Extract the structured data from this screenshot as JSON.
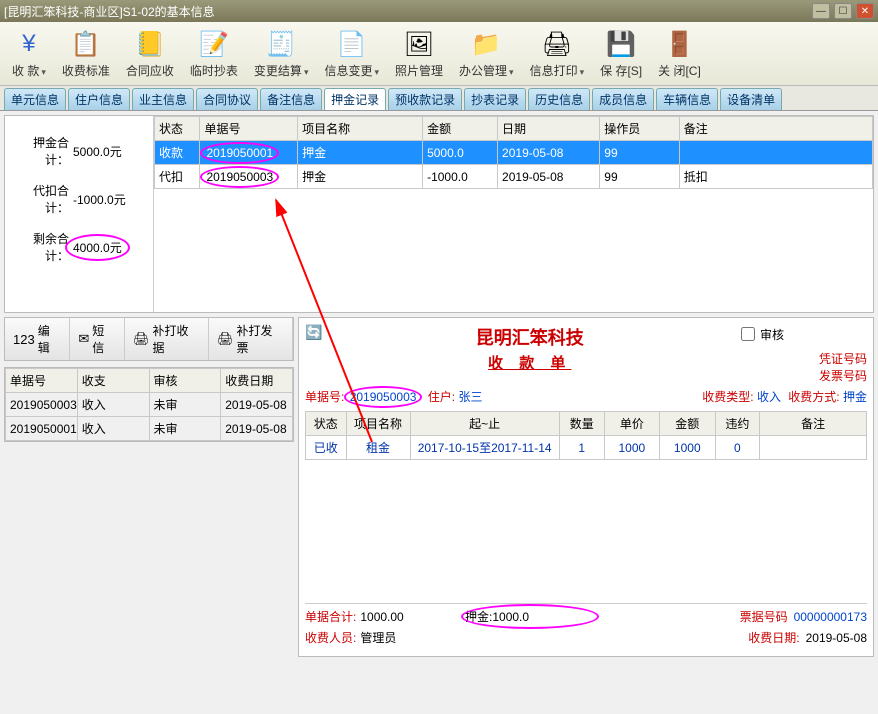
{
  "title": "[昆明汇笨科技-商业区]S1-02的基本信息",
  "toolbar": [
    {
      "icon": "¥",
      "color": "#3366cc",
      "label": "收 款",
      "dd": true
    },
    {
      "icon": "📋",
      "label": "收费标准"
    },
    {
      "icon": "📒",
      "label": "合同应收"
    },
    {
      "icon": "📝",
      "label": "临时抄表"
    },
    {
      "icon": "🧾",
      "label": "变更结算",
      "dd": true
    },
    {
      "icon": "📄",
      "label": "信息变更",
      "dd": true
    },
    {
      "icon": "🖼",
      "label": "照片管理"
    },
    {
      "icon": "📁",
      "label": "办公管理",
      "dd": true
    },
    {
      "icon": "🖨",
      "label": "信息打印",
      "dd": true
    },
    {
      "icon": "💾",
      "label": "保 存[S]"
    },
    {
      "icon": "🚪",
      "label": "关 闭[C]"
    }
  ],
  "tabs": [
    "单元信息",
    "住户信息",
    "业主信息",
    "合同协议",
    "备注信息",
    "押金记录",
    "预收款记录",
    "抄表记录",
    "历史信息",
    "成员信息",
    "车辆信息",
    "设备清单"
  ],
  "summary": {
    "deposit_label": "押金合计：",
    "deposit": "5000.0元",
    "deduct_label": "代扣合计：",
    "deduct": "-1000.0元",
    "remain_label": "剩余合计：",
    "remain": "4000.0元"
  },
  "grid1": {
    "headers": [
      "状态",
      "单据号",
      "项目名称",
      "金额",
      "日期",
      "操作员",
      "备注"
    ],
    "widths": [
      40,
      86,
      110,
      66,
      90,
      70,
      170
    ],
    "rows": [
      {
        "cells": [
          "收款",
          "2019050001",
          "押金",
          "5000.0",
          "2019-05-08",
          "99",
          ""
        ],
        "sel": true,
        "oval": 1
      },
      {
        "cells": [
          "代扣",
          "2019050003",
          "押金",
          "-1000.0",
          "2019-05-08",
          "99",
          "抵扣"
        ],
        "oval": 1
      }
    ]
  },
  "actions": [
    {
      "ic": "123",
      "label": "编辑"
    },
    {
      "ic": "✉",
      "label": "短信"
    },
    {
      "ic": "🖨",
      "label": "补打收据"
    },
    {
      "ic": "🖨",
      "label": "补打发票"
    }
  ],
  "grid2": {
    "headers": [
      "单据号",
      "收支",
      "审核",
      "收费日期"
    ],
    "rows": [
      [
        "2019050003",
        "收入",
        "未审",
        "2019-05-08"
      ],
      [
        "2019050001",
        "收入",
        "未审",
        "2019-05-08"
      ]
    ]
  },
  "receipt": {
    "title": "昆明汇笨科技",
    "subtitle": "收 款 单",
    "audit_label": "审核",
    "voucher_label": "凭证号码",
    "invoice_code_label": "发票号码",
    "doc_label": "单据号:",
    "doc": "2019050003",
    "cust_label": "住户:",
    "cust": "张三",
    "feetype_label": "收费类型:",
    "feetype": "收入",
    "paymode_label": "收费方式:",
    "paymode": "押金",
    "headers": [
      "状态",
      "项目名称",
      "起~止",
      "数量",
      "单价",
      "金额",
      "违约",
      "备注"
    ],
    "widths": [
      38,
      60,
      140,
      42,
      52,
      52,
      42,
      100
    ],
    "rows": [
      [
        "已收",
        "租金",
        "2017-10-15至2017-11-14",
        "1",
        "1000",
        "1000",
        "0",
        ""
      ]
    ],
    "foot": {
      "total_label": "单据合计:",
      "total": "1000.00",
      "deposit_label": "押金:",
      "deposit": "1000.0",
      "invno_label": "票据号码",
      "invno": "00000000173",
      "clerk_label": "收费人员:",
      "clerk": "管理员",
      "date_label": "收费日期:",
      "date": "2019-05-08"
    }
  }
}
